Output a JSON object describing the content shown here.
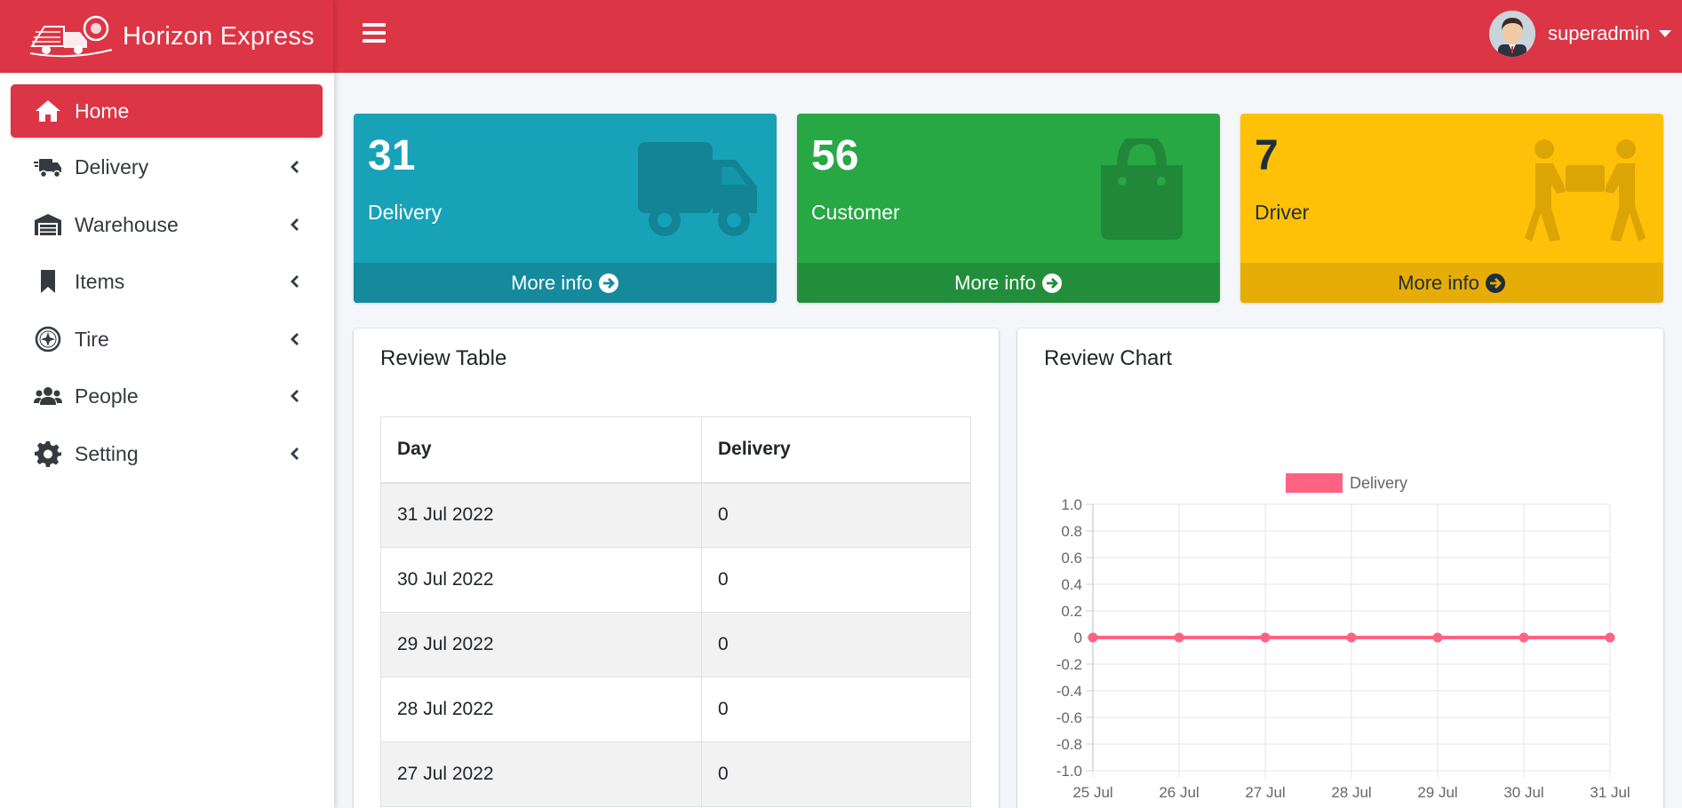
{
  "brand": {
    "name_bold": "Horizon",
    "name_light": "Express"
  },
  "user": {
    "name": "superadmin"
  },
  "sidebar": {
    "items": [
      {
        "label": "Home",
        "icon": "home-icon",
        "active": true
      },
      {
        "label": "Delivery",
        "icon": "truck-fast-icon"
      },
      {
        "label": "Warehouse",
        "icon": "warehouse-icon"
      },
      {
        "label": "Items",
        "icon": "bookmark-icon"
      },
      {
        "label": "Tire",
        "icon": "tire-icon"
      },
      {
        "label": "People",
        "icon": "users-icon"
      },
      {
        "label": "Setting",
        "icon": "gear-icon"
      }
    ]
  },
  "stats": [
    {
      "value": "31",
      "label": "Delivery",
      "footer": "More info",
      "icon": "truck-icon",
      "color": "#17a2b8"
    },
    {
      "value": "56",
      "label": "Customer",
      "footer": "More info",
      "icon": "shopping-bag-icon",
      "color": "#28a745"
    },
    {
      "value": "7",
      "label": "Driver",
      "footer": "More info",
      "icon": "people-carry-icon",
      "color": "#ffc107"
    }
  ],
  "review_table": {
    "title": "Review Table",
    "headers": [
      "Day",
      "Delivery"
    ],
    "rows": [
      [
        "31 Jul 2022",
        "0"
      ],
      [
        "30 Jul 2022",
        "0"
      ],
      [
        "29 Jul 2022",
        "0"
      ],
      [
        "28 Jul 2022",
        "0"
      ],
      [
        "27 Jul 2022",
        "0"
      ]
    ]
  },
  "review_chart": {
    "title": "Review Chart"
  },
  "chart_data": {
    "type": "line",
    "x": [
      "25 Jul",
      "26 Jul",
      "27 Jul",
      "28 Jul",
      "29 Jul",
      "30 Jul",
      "31 Jul"
    ],
    "series": [
      {
        "name": "Delivery",
        "values": [
          0,
          0,
          0,
          0,
          0,
          0,
          0
        ],
        "color": "#ff6384"
      }
    ],
    "yticks": [
      "1.0",
      "0.8",
      "0.6",
      "0.4",
      "0.2",
      "0",
      "-0.2",
      "-0.4",
      "-0.6",
      "-0.8",
      "-1.0"
    ],
    "ylim": [
      -1,
      1
    ],
    "grid": true,
    "legend": "top"
  }
}
